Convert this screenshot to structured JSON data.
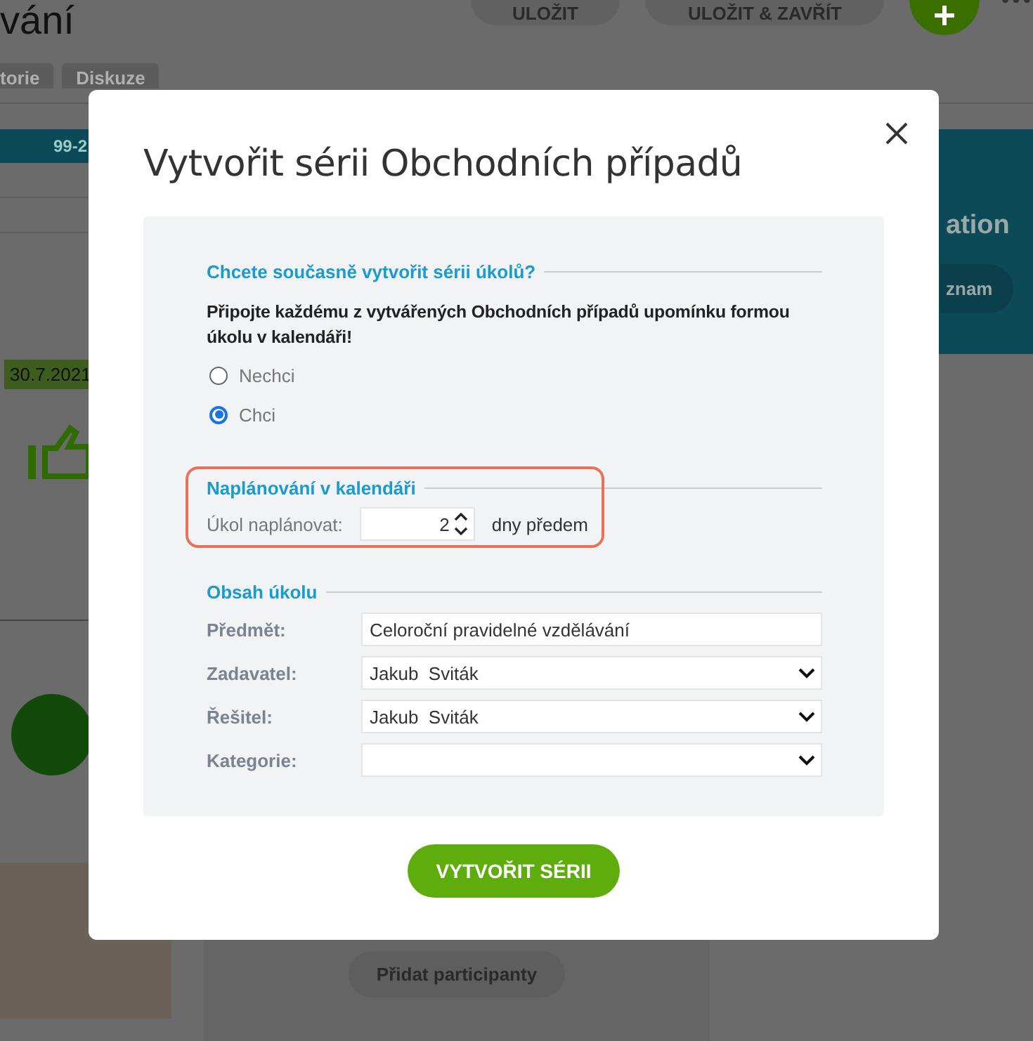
{
  "background": {
    "page_title": "vání",
    "header_buttons": [
      "ULOŽIT",
      "ULOŽIT & ZAVŘÍT"
    ],
    "tabs": [
      "torie",
      "Diskuze"
    ],
    "teal_bar_text": "99-2",
    "date_badge": "30.7.2021",
    "side_panel": {
      "heading": "ation",
      "button": "znam"
    },
    "add_participants_button": "Přidat participanty"
  },
  "dialog": {
    "title": "Vytvořit sérii Obchodních případů",
    "task_series": {
      "heading": "Chcete současně vytvořit sérii úkolů?",
      "prompt": "Připojte každému z vytvářených Obchodních případů upomínku formou úkolu v kalendáři!",
      "options": [
        {
          "label": "Nechci",
          "selected": false
        },
        {
          "label": "Chci",
          "selected": true
        }
      ]
    },
    "scheduling": {
      "heading": "Naplánování v kalendáři",
      "highlighted": true,
      "label": "Úkol naplánovat:",
      "value": "2",
      "unit": "dny předem"
    },
    "task_content": {
      "heading": "Obsah úkolu",
      "fields": [
        {
          "kind": "text",
          "label": "Předmět:",
          "value": "Celoroční pravidelné vzdělávání"
        },
        {
          "kind": "select",
          "label": "Zadavatel:",
          "value": "Jakub  Sviták"
        },
        {
          "kind": "select",
          "label": "Řešitel:",
          "value": "Jakub  Sviták"
        },
        {
          "kind": "select",
          "label": "Kategorie:"
        }
      ]
    },
    "submit_button": "VYTVOŘIT SÉRII"
  }
}
